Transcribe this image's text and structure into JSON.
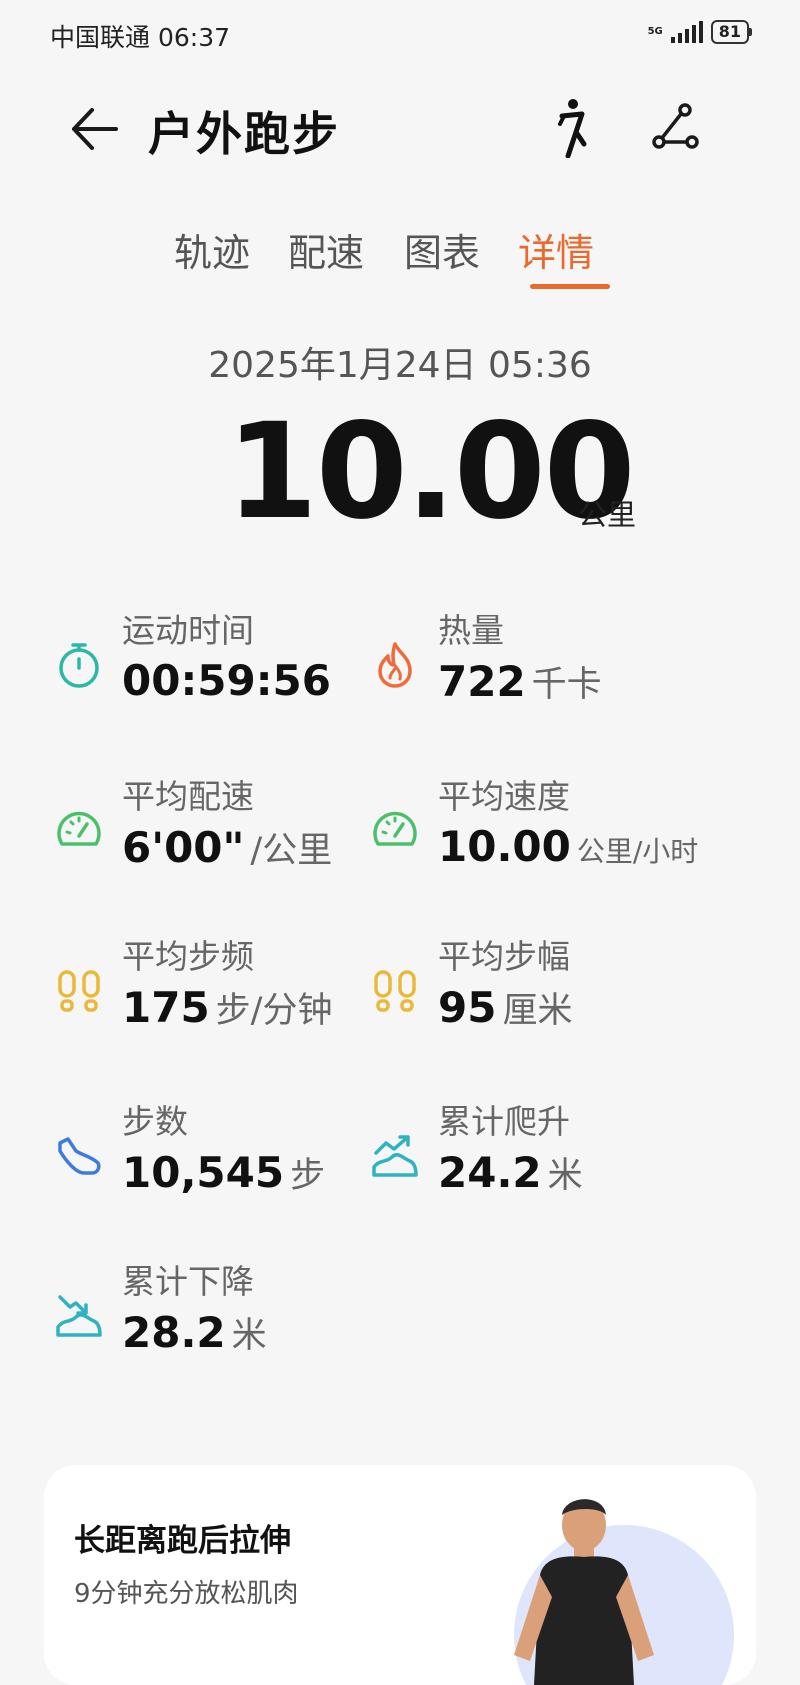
{
  "status_bar": {
    "carrier": "中国联通",
    "time": "06:37",
    "network": "5G",
    "battery": "81"
  },
  "header": {
    "title": "户外跑步",
    "runner_icon": "runner-icon",
    "share_icon": "route-share-icon"
  },
  "tabs": [
    {
      "label": "轨迹",
      "active": false
    },
    {
      "label": "配速",
      "active": false
    },
    {
      "label": "图表",
      "active": false
    },
    {
      "label": "详情",
      "active": true
    }
  ],
  "summary": {
    "date": "2025年1月24日 05:36",
    "distance": "10.00",
    "distance_unit": "公里"
  },
  "metrics": [
    {
      "label": "运动时间",
      "value": "00:59:56",
      "unit": "",
      "icon": "stopwatch-icon"
    },
    {
      "label": "热量",
      "value": "722",
      "unit": "千卡",
      "icon": "flame-icon"
    },
    {
      "label": "平均配速",
      "value": "6'00\"",
      "unit": "/公里",
      "icon": "speedometer-icon"
    },
    {
      "label": "平均速度",
      "value": "10.00",
      "unit": "公里/小时",
      "icon": "speedometer-icon"
    },
    {
      "label": "平均步频",
      "value": "175",
      "unit": "步/分钟",
      "icon": "footprints-icon"
    },
    {
      "label": "平均步幅",
      "value": "95",
      "unit": "厘米",
      "icon": "footprints-icon"
    },
    {
      "label": "步数",
      "value": "10,545",
      "unit": "步",
      "icon": "shoe-icon"
    },
    {
      "label": "累计爬升",
      "value": "24.2",
      "unit": "米",
      "icon": "ascent-icon"
    },
    {
      "label": "累计下降",
      "value": "28.2",
      "unit": "米",
      "icon": "descent-icon"
    }
  ],
  "colors": {
    "accent": "#e86a2c",
    "teal": "#2bb8a4",
    "green": "#4cbf6b",
    "orange": "#f06a3a",
    "yellow": "#e8b93a",
    "blue": "#3d7be0",
    "cyan": "#2fb3c2"
  },
  "promo_card": {
    "title": "长距离跑后拉伸",
    "subtitle": "9分钟充分放松肌肉"
  }
}
